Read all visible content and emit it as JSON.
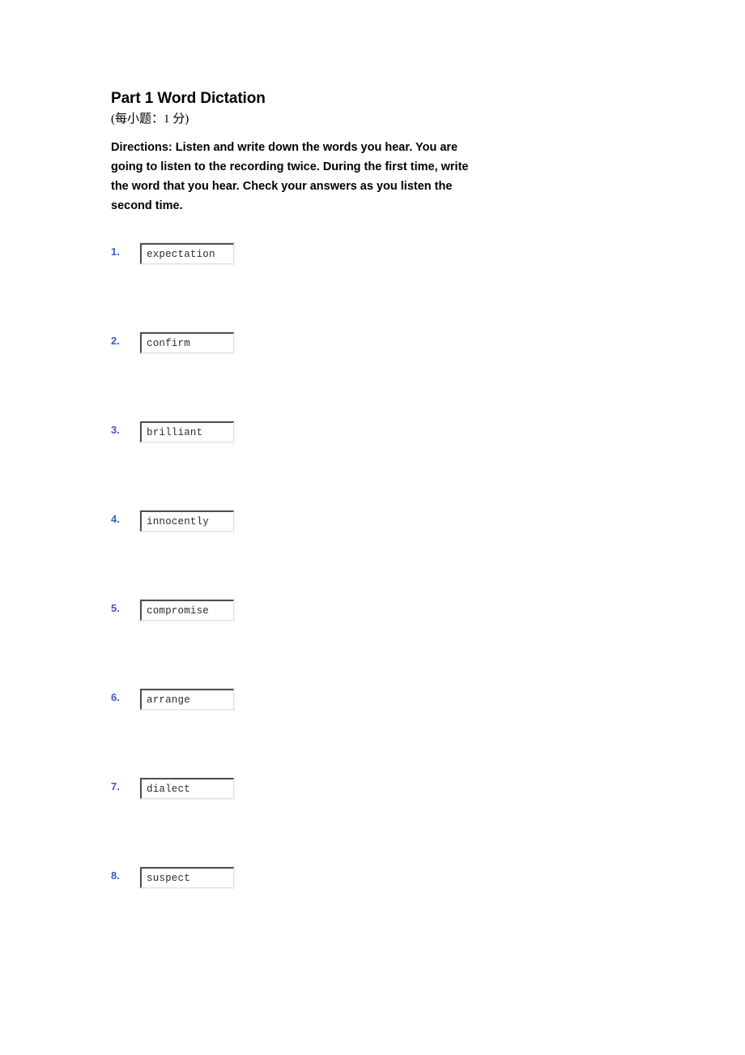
{
  "document": {
    "title": "Part 1 Word Dictation",
    "score_note": "(每小题：1 分)",
    "directions": "Directions: Listen and write down the words you hear. You are going to listen to the recording twice. During the first time, write the word that you hear. Check your answers as you listen the second time."
  },
  "style": {
    "number_color": "#3a5bbf",
    "answer_text_color": "#2b2b2b",
    "page_background": "#ffffff"
  },
  "items": [
    {
      "number": "1.",
      "answer": "expectation"
    },
    {
      "number": "2.",
      "answer": "confirm"
    },
    {
      "number": "3.",
      "answer": "brilliant"
    },
    {
      "number": "4.",
      "answer": "innocently"
    },
    {
      "number": "5.",
      "answer": "compromise"
    },
    {
      "number": "6.",
      "answer": "arrange"
    },
    {
      "number": "7.",
      "answer": "dialect"
    },
    {
      "number": "8.",
      "answer": "suspect"
    }
  ]
}
